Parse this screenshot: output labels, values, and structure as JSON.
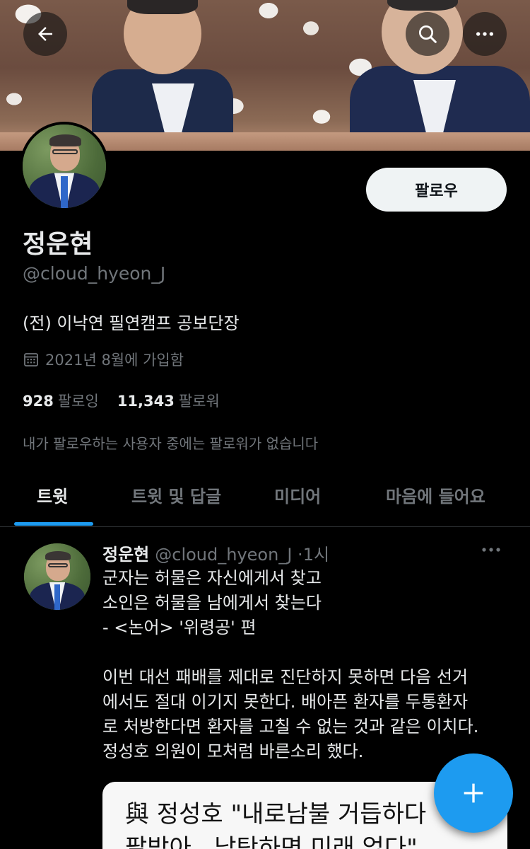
{
  "header": {
    "back_icon": "arrow-left-icon",
    "search_icon": "search-icon",
    "more_icon": "more-horizontal-icon"
  },
  "profile": {
    "follow_label": "팔로우",
    "name": "정운현",
    "handle": "@cloud_hyeon_J",
    "bio": "(전) 이낙연 필연캠프 공보단장",
    "joined": "2021년 8월에 가입함",
    "following_count": "928",
    "following_label": "팔로잉",
    "followers_count": "11,343",
    "followers_label": "팔로워",
    "not_followed_note": "내가 팔로우하는 사용자 중에는 팔로워가 없습니다"
  },
  "tabs": [
    {
      "label": "트윗",
      "active": true
    },
    {
      "label": "트윗 및 답글",
      "active": false
    },
    {
      "label": "미디어",
      "active": false
    },
    {
      "label": "마음에 들어요",
      "active": false
    }
  ],
  "tweet": {
    "author_name": "정운현",
    "author_handle": "@cloud_hyeon_J",
    "separator": "·",
    "time": "1시",
    "body": "군자는 허물은 자신에게서 찾고\n소인은 허물을 남에게서 찾는다\n- <논어> '위령공' 편\n\n이번 대선 패배를 제대로 진단하지 못하면 다음 선거\n에서도 절대 이기지 못한다. 배아픈 환자를 두통환자\n로 처방한다면 환자를 고칠 수 없는 것과 같은 이치다.\n정성호 의원이 모처럼 바른소리 했다.",
    "card_line1": "與 정성호 \"내로남불 거듭하다",
    "card_line2": "팔받아...남탓하면 미래 없다\""
  },
  "colors": {
    "accent": "#1d9bf0",
    "background": "#000000",
    "text_primary": "#e7e9ea",
    "text_secondary": "#71767b"
  }
}
